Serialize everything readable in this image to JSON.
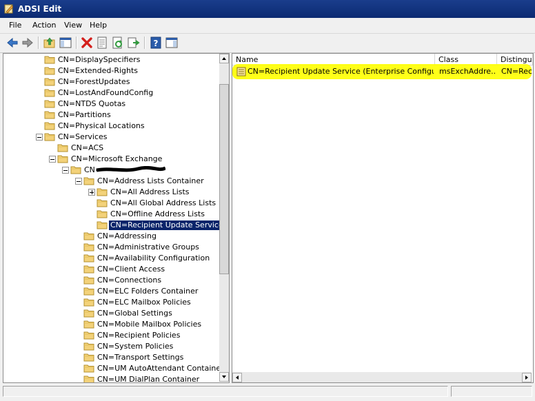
{
  "window": {
    "title": "ADSI Edit"
  },
  "menu": [
    "File",
    "Action",
    "View",
    "Help"
  ],
  "toolbar": [
    {
      "name": "back-arrow-icon"
    },
    {
      "name": "forward-arrow-icon"
    },
    {
      "name": "up-folder-icon"
    },
    {
      "name": "show-hide-tree-icon"
    },
    {
      "name": "delete-icon"
    },
    {
      "name": "properties-icon"
    },
    {
      "name": "refresh-icon"
    },
    {
      "name": "export-list-icon"
    },
    {
      "name": "help-icon"
    },
    {
      "name": "action-pane-icon"
    }
  ],
  "tree": {
    "nodes": [
      {
        "label": "CN=DisplaySpecifiers"
      },
      {
        "label": "CN=Extended-Rights"
      },
      {
        "label": "CN=ForestUpdates"
      },
      {
        "label": "CN=LostAndFoundConfig"
      },
      {
        "label": "CN=NTDS Quotas"
      },
      {
        "label": "CN=Partitions"
      },
      {
        "label": "CN=Physical Locations"
      },
      {
        "label": "CN=Services",
        "expander": "minus"
      },
      {
        "label": "CN=ACS"
      },
      {
        "label": "CN=Microsoft Exchange",
        "expander": "minus"
      },
      {
        "label": "CN=",
        "expander": "minus",
        "redacted": true
      },
      {
        "label": "CN=Address Lists Container",
        "expander": "minus"
      },
      {
        "label": "CN=All Address Lists",
        "expander": "plus"
      },
      {
        "label": "CN=All Global Address Lists"
      },
      {
        "label": "CN=Offline Address Lists"
      },
      {
        "label": "CN=Recipient Update Services",
        "selected": true
      },
      {
        "label": "CN=Addressing"
      },
      {
        "label": "CN=Administrative Groups"
      },
      {
        "label": "CN=Availability Configuration"
      },
      {
        "label": "CN=Client Access"
      },
      {
        "label": "CN=Connections"
      },
      {
        "label": "CN=ELC Folders Container"
      },
      {
        "label": "CN=ELC Mailbox Policies"
      },
      {
        "label": "CN=Global Settings"
      },
      {
        "label": "CN=Mobile Mailbox Policies"
      },
      {
        "label": "CN=Recipient Policies"
      },
      {
        "label": "CN=System Policies"
      },
      {
        "label": "CN=Transport Settings"
      },
      {
        "label": "CN=UM AutoAttendant Container"
      },
      {
        "label": "CN=UM DialPlan Container"
      }
    ]
  },
  "list": {
    "columns": [
      "Name",
      "Class",
      "Distinguis"
    ],
    "rows": [
      {
        "name": "CN=Recipient Update Service (Enterprise Configuration)",
        "class": "msExchAddre...",
        "dn": "CN=Reci"
      }
    ]
  },
  "colors": {
    "title_bar": "#0b2a72",
    "selection": "#0a246a",
    "highlight": "#ffff00",
    "folder": "#f3d27a"
  }
}
